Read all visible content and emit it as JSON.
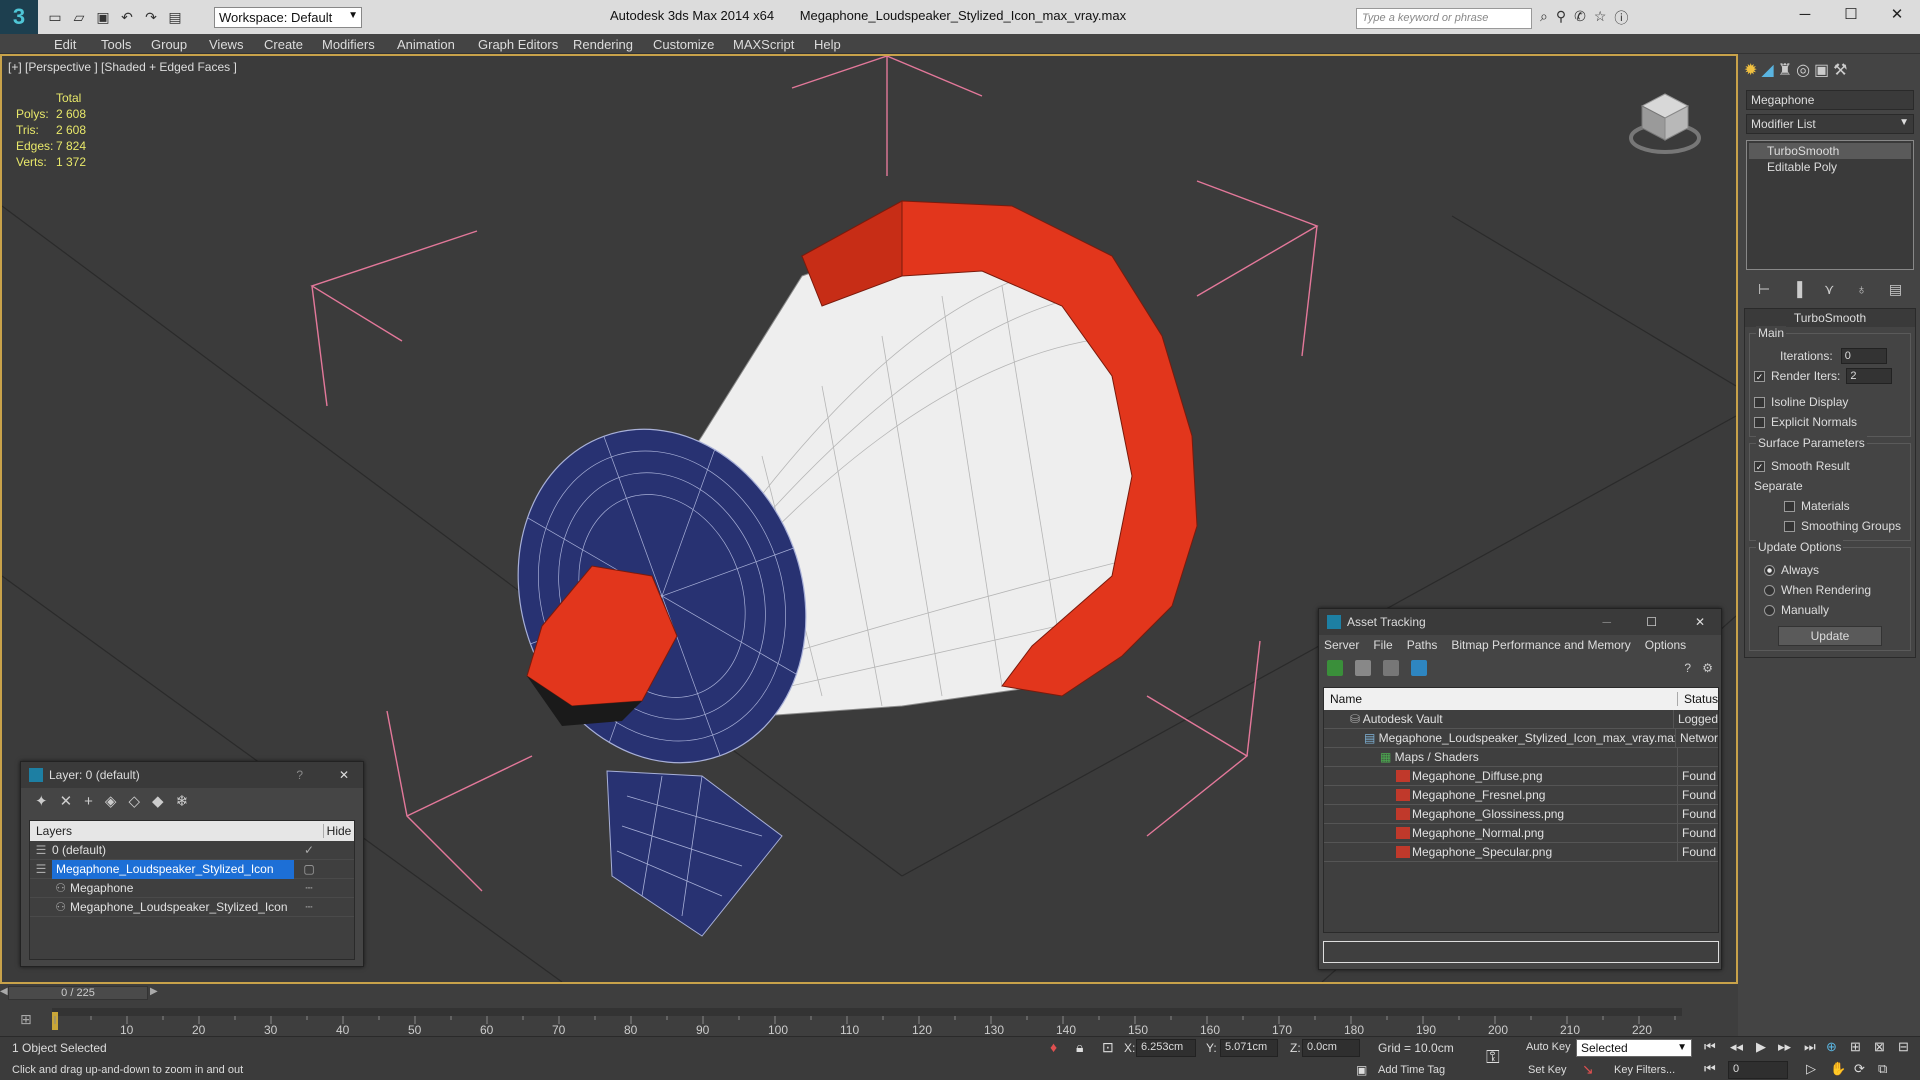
{
  "window": {
    "logo": "3",
    "title_app": "Autodesk 3ds Max  2014 x64",
    "title_file": "Megaphone_Loudspeaker_Stylized_Icon_max_vray.max",
    "search_placeholder": "Type a keyword or phrase",
    "minimize": "─",
    "maximize": "☐",
    "close": "✕"
  },
  "workspace": {
    "label": "Workspace: Default"
  },
  "menu": [
    "Edit",
    "Tools",
    "Group",
    "Views",
    "Create",
    "Modifiers",
    "Animation",
    "Graph Editors",
    "Rendering",
    "Customize",
    "MAXScript",
    "Help"
  ],
  "viewport": {
    "label": "[+] [Perspective ] [Shaded + Edged Faces ]",
    "stats": {
      "header": "Total",
      "rows": [
        {
          "k": "Polys:",
          "v": "2 608"
        },
        {
          "k": "Tris:",
          "v": "2 608"
        },
        {
          "k": "Edges:",
          "v": "7 824"
        },
        {
          "k": "Verts:",
          "v": "1 372"
        }
      ]
    }
  },
  "layer_window": {
    "title": "Layer: 0 (default)",
    "help": "?",
    "close": "✕",
    "col_layers": "Layers",
    "col_hide": "Hide",
    "rows": [
      {
        "name": "0 (default)",
        "indent": 1,
        "hide": "✓"
      },
      {
        "name": "Megaphone_Loudspeaker_Stylized_Icon",
        "indent": 1,
        "hide": ""
      },
      {
        "name": "Megaphone",
        "indent": 2,
        "hide": ""
      },
      {
        "name": "Megaphone_Loudspeaker_Stylized_Icon",
        "indent": 2,
        "hide": ""
      }
    ]
  },
  "asset_window": {
    "title": "Asset Tracking",
    "menu": [
      "Server",
      "File",
      "Paths",
      "Bitmap Performance and Memory",
      "Options"
    ],
    "col_name": "Name",
    "col_status": "Status",
    "rows": [
      {
        "name": "Autodesk Vault",
        "status": "Logged",
        "indent": 1,
        "icon": "vault"
      },
      {
        "name": "Megaphone_Loudspeaker_Stylized_Icon_max_vray.max",
        "status": "Networ",
        "indent": 2,
        "icon": "max"
      },
      {
        "name": "Maps / Shaders",
        "status": "",
        "indent": 3,
        "icon": "maps"
      },
      {
        "name": "Megaphone_Diffuse.png",
        "status": "Found",
        "indent": 4,
        "icon": "png"
      },
      {
        "name": "Megaphone_Fresnel.png",
        "status": "Found",
        "indent": 4,
        "icon": "png"
      },
      {
        "name": "Megaphone_Glossiness.png",
        "status": "Found",
        "indent": 4,
        "icon": "png"
      },
      {
        "name": "Megaphone_Normal.png",
        "status": "Found",
        "indent": 4,
        "icon": "png"
      },
      {
        "name": "Megaphone_Specular.png",
        "status": "Found",
        "indent": 4,
        "icon": "png"
      }
    ]
  },
  "command_panel": {
    "object_name": "Megaphone",
    "modifier_list": "Modifier List",
    "stack": [
      "TurboSmooth",
      "Editable Poly"
    ],
    "rollout_title": "TurboSmooth",
    "group_main": "Main",
    "iterations_label": "Iterations:",
    "iterations_value": "0",
    "render_iters_label": "Render Iters:",
    "render_iters_value": "2",
    "isoline_label": "Isoline Display",
    "explicit_normals_label": "Explicit Normals",
    "group_surface": "Surface Parameters",
    "smooth_result_label": "Smooth Result",
    "separate_label": "Separate",
    "materials_label": "Materials",
    "smoothing_groups_label": "Smoothing Groups",
    "group_update": "Update Options",
    "always_label": "Always",
    "when_rendering_label": "When Rendering",
    "manually_label": "Manually",
    "update_button": "Update"
  },
  "timeline": {
    "frame_display": "0 / 225",
    "ticks": [
      "10",
      "20",
      "30",
      "40",
      "50",
      "60",
      "70",
      "80",
      "90",
      "100",
      "110",
      "120",
      "130",
      "140",
      "150",
      "160",
      "170",
      "180",
      "190",
      "200",
      "210",
      "220"
    ]
  },
  "status": {
    "selection": "1 Object Selected",
    "prompt": "Click and drag up-and-down to zoom in and out",
    "x_label": "X:",
    "x_value": "6.253cm",
    "y_label": "Y:",
    "y_value": "5.071cm",
    "z_label": "Z:",
    "z_value": "0.0cm",
    "grid": "Grid = 10.0cm",
    "add_time_tag": "Add Time Tag",
    "auto_key": "Auto Key",
    "set_key": "Set Key",
    "selected_option": "Selected",
    "key_filters": "Key Filters...",
    "frame_value": "0"
  },
  "colors": {
    "viewport_bg": "#3b3b3b",
    "megaphone_red": "#e2361c",
    "megaphone_white": "#f2f2f2",
    "megaphone_navy": "#283272",
    "selection_blue": "#1d6fd6",
    "gizmo_pink": "#e3789a"
  }
}
